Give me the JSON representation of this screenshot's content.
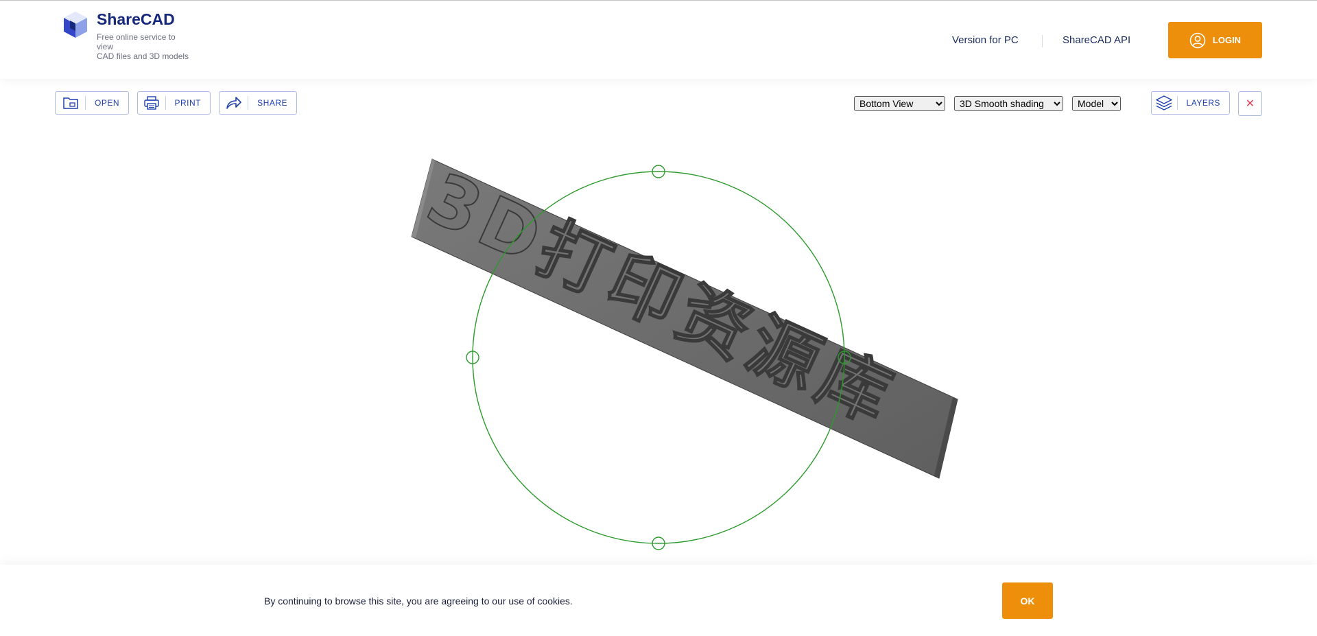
{
  "header": {
    "brand": "ShareCAD",
    "tagline": "Free online service to view\nCAD files and 3D models",
    "nav": {
      "version_pc": "Version for PC",
      "api": "ShareCAD API"
    },
    "login_label": "LOGIN"
  },
  "toolbar": {
    "open_label": "OPEN",
    "print_label": "PRINT",
    "share_label": "SHARE",
    "view_select": {
      "selected": "Bottom View"
    },
    "shading_select": {
      "selected": "3D Smooth shading"
    },
    "space_select": {
      "selected": "Model"
    },
    "layers_label": "LAYERS",
    "close_symbol": "✕"
  },
  "viewer": {
    "model_text": "3D打印资源库",
    "orbit_color": "#2b9a2b",
    "model_color": "#6e6e6e"
  },
  "cookie": {
    "message": "By continuing to browse this site, you are agreeing to our use of cookies.",
    "ok_label": "OK"
  },
  "colors": {
    "accent": "#ee8f0c",
    "brand": "#16287a",
    "link": "#1d3fae"
  }
}
